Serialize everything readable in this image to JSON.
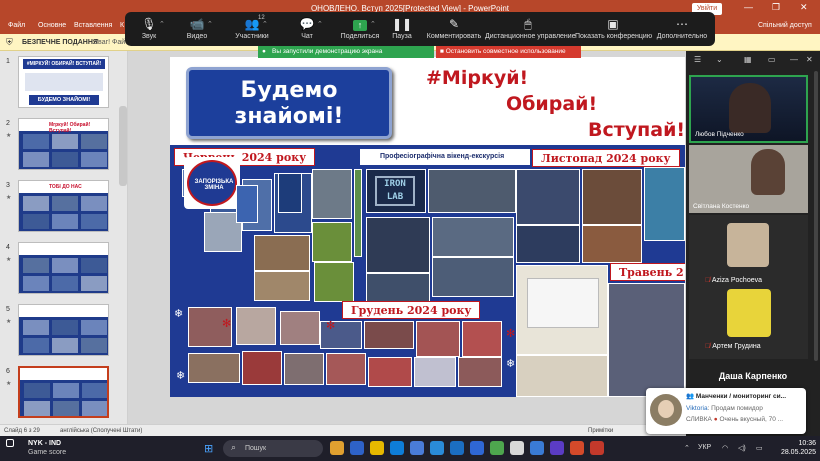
{
  "window": {
    "title": "ОНОВЛЕНО. Вступ 2025[Protected View] - PowerPoint",
    "signin": "Увійти",
    "min": "—",
    "restore": "❐",
    "close": "✕"
  },
  "ribbon": {
    "tabs": [
      "Файл",
      "Основне",
      "Вставлення",
      "К"
    ],
    "share": "Спільний доступ"
  },
  "protected_view": {
    "title": "БЕЗПЕЧНЕ ПОДАННЯ",
    "message": "Уваг! Фай"
  },
  "meeting_toolbar": {
    "items": [
      {
        "label": "Звук",
        "icon": "microphone-icon",
        "glyph": "🎙"
      },
      {
        "label": "Видео",
        "icon": "video-camera-icon",
        "glyph": "📹"
      },
      {
        "label": "Участники",
        "icon": "participants-icon",
        "glyph": "👥",
        "count": "12"
      },
      {
        "label": "Чат",
        "icon": "chat-icon",
        "glyph": "💬"
      },
      {
        "label": "Поделиться",
        "icon": "share-screen-icon",
        "glyph": "↑"
      },
      {
        "label": "Пауза",
        "icon": "pause-icon",
        "glyph": "❚❚"
      },
      {
        "label": "Комментировать",
        "icon": "annotate-pen-icon",
        "glyph": "✎"
      },
      {
        "label": "Дистанционное управление",
        "icon": "remote-control-mouse-icon",
        "glyph": "🖱"
      },
      {
        "label": "Показать конференцию",
        "icon": "show-conference-icon",
        "glyph": "▣"
      },
      {
        "label": "Дополнительно",
        "icon": "more-icon",
        "glyph": "⋯"
      }
    ],
    "share_banner": "Вы запустили демонстрацию экрана",
    "stop_banner": "Остановить совместное использование"
  },
  "thumbnails": [
    {
      "num": "1",
      "title": "#МІРКУЙ! ОБИРАЙ! ВСТУПАЙ!",
      "subtitle": "БУДЕМО ЗНАЙОМІ!",
      "star": false
    },
    {
      "num": "2",
      "title": "Мrpкуй! Обирай! Вступай!",
      "star": true
    },
    {
      "num": "3",
      "title": "ТОБІ ДО НАС",
      "star": true
    },
    {
      "num": "4",
      "title": "",
      "star": true
    },
    {
      "num": "5",
      "title": "",
      "star": true
    },
    {
      "num": "6",
      "title": "",
      "star": true
    }
  ],
  "slide": {
    "title": "Будемо знайомі!",
    "hashtag": "#Міркуй!",
    "choose": "Обирай!",
    "enter": "Вступай!",
    "june": "Червень 2024 року",
    "weekend": "Професіографічна вікенд-екскурсія",
    "iron_lab": "IRON LAB",
    "november": "Листопад 2024 року",
    "may": "Травень 2",
    "december": "Грудень 2024 року",
    "logo_text": "ЗАПОРІЗЬКА ЗМІНА"
  },
  "statusbar": {
    "slide_info": "Слайд 6 з 29",
    "language": "англійська (Сполучені Штати)",
    "notes": "Примітки"
  },
  "video_panel": {
    "participants": [
      {
        "name": "Любов Підченко",
        "active": true
      },
      {
        "name": "Світлана Костенко",
        "active": false
      },
      {
        "name": "Aziza Pochoeva",
        "active": false
      },
      {
        "name": "Артем Грудина",
        "active": false
      }
    ],
    "current_speaker": "Даша Карпенко"
  },
  "notification": {
    "chat": "Манченки / мониторинг си...",
    "sender": "Viktoria",
    "message": ": Продам помидор",
    "line3": "СЛИВКА",
    "line3_rest": "Очень вкусный, 70 ..."
  },
  "taskbar": {
    "game_title": "NYK - IND",
    "game_sub": "Game score",
    "search_placeholder": "Пошук",
    "lang": "УКР",
    "time": "10:36",
    "date": "28.05.2025"
  },
  "colors": {
    "ppt_red": "#b7472a",
    "slide_blue": "#1f3a93",
    "accent_red": "#c0181f",
    "share_green": "#2ea44f",
    "stop_red": "#d53a2e"
  }
}
